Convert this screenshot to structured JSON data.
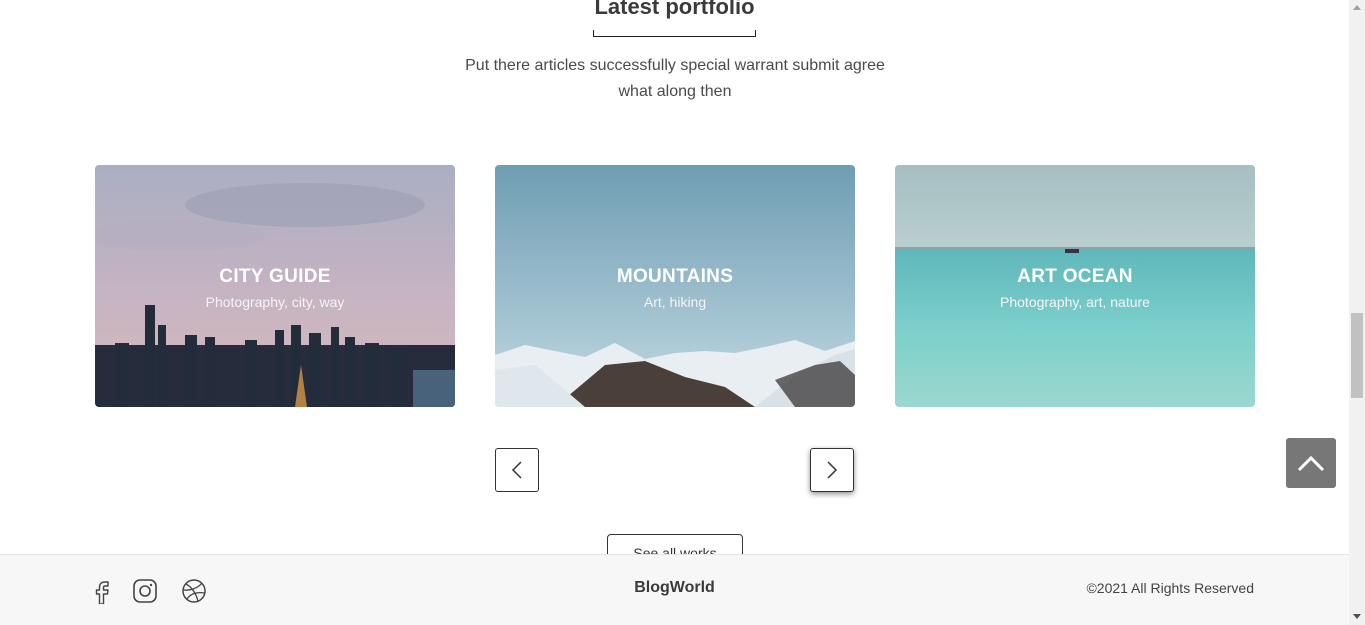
{
  "section": {
    "title": "Latest portfolio",
    "subtitle": "Put there articles successfully special warrant submit agree what along then"
  },
  "cards": [
    {
      "title": "CITY GUIDE",
      "tags": "Photography, city, way"
    },
    {
      "title": "MOUNTAINS",
      "tags": "Art, hiking"
    },
    {
      "title": "ART OCEAN",
      "tags": "Photography, art, nature"
    }
  ],
  "carousel": {
    "prev_icon": "chevron-left-icon",
    "next_icon": "chevron-right-icon"
  },
  "see_all_label": "See all works",
  "footer": {
    "social": [
      "facebook-icon",
      "instagram-icon",
      "dribbble-icon"
    ],
    "brand": "BlogWorld",
    "copyright": "©2021 All Rights Reserved"
  },
  "colors": {
    "accent": "#3a3a3a",
    "footer_bg": "#f7f7f7",
    "to_top_bg": "#777777"
  }
}
